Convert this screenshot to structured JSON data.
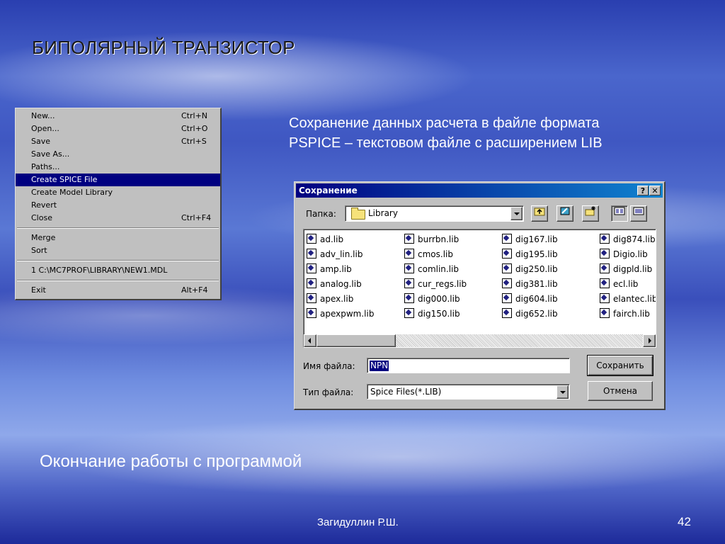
{
  "slide": {
    "title": "БИПОЛЯРНЫЙ ТРАНЗИСТОР",
    "description_lines": [
      "Сохранение данных расчета в файле формата",
      "PSPICE – текстовом файле с расширением LIB"
    ],
    "ending_text": "Окончание работы с программой",
    "author": "Загидуллин Р.Ш.",
    "page_number": "42"
  },
  "menu": {
    "items": [
      {
        "label": "New...",
        "shortcut": "Ctrl+N"
      },
      {
        "label": "Open...",
        "shortcut": "Ctrl+O"
      },
      {
        "label": "Save",
        "shortcut": "Ctrl+S"
      },
      {
        "label": "Save As...",
        "shortcut": ""
      },
      {
        "label": "Paths...",
        "shortcut": ""
      },
      {
        "label": "Create SPICE File",
        "shortcut": "",
        "active": true
      },
      {
        "label": "Create Model Library",
        "shortcut": ""
      },
      {
        "label": "Revert",
        "shortcut": ""
      },
      {
        "label": "Close",
        "shortcut": "Ctrl+F4"
      },
      {
        "label": "Merge",
        "shortcut": ""
      },
      {
        "label": "Sort",
        "shortcut": ""
      },
      {
        "label": "1 C:\\MC7PROF\\LIBRARY\\NEW1.MDL",
        "shortcut": ""
      },
      {
        "label": "Exit",
        "shortcut": "Alt+F4"
      }
    ]
  },
  "dialog": {
    "title": "Сохранение",
    "help_button": "?",
    "close_button": "✕",
    "folder_label": "Папка:",
    "folder_value": "Library",
    "file_columns": [
      [
        "ad.lib",
        "adv_lin.lib",
        "amp.lib",
        "analog.lib",
        "apex.lib",
        "apexpwm.lib"
      ],
      [
        "burrbn.lib",
        "cmos.lib",
        "comlin.lib",
        "cur_regs.lib",
        "dig000.lib",
        "dig150.lib"
      ],
      [
        "dig167.lib",
        "dig195.lib",
        "dig250.lib",
        "dig381.lib",
        "dig604.lib",
        "dig652.lib"
      ],
      [
        "dig874.lib",
        "Digio.lib",
        "digpld.lib",
        "ecl.lib",
        "elantec.lib",
        "fairch.lib"
      ]
    ],
    "filename_label": "Имя файла:",
    "filename_value": "NPN",
    "filetype_label": "Тип файла:",
    "filetype_value": "Spice Files(*.LIB)",
    "save_button": "Сохранить",
    "cancel_button": "Отмена"
  },
  "colors": {
    "menu_highlight": "#000080",
    "titlebar_start": "#000080",
    "titlebar_end": "#1084d0",
    "window_face": "#c0c0c0"
  }
}
